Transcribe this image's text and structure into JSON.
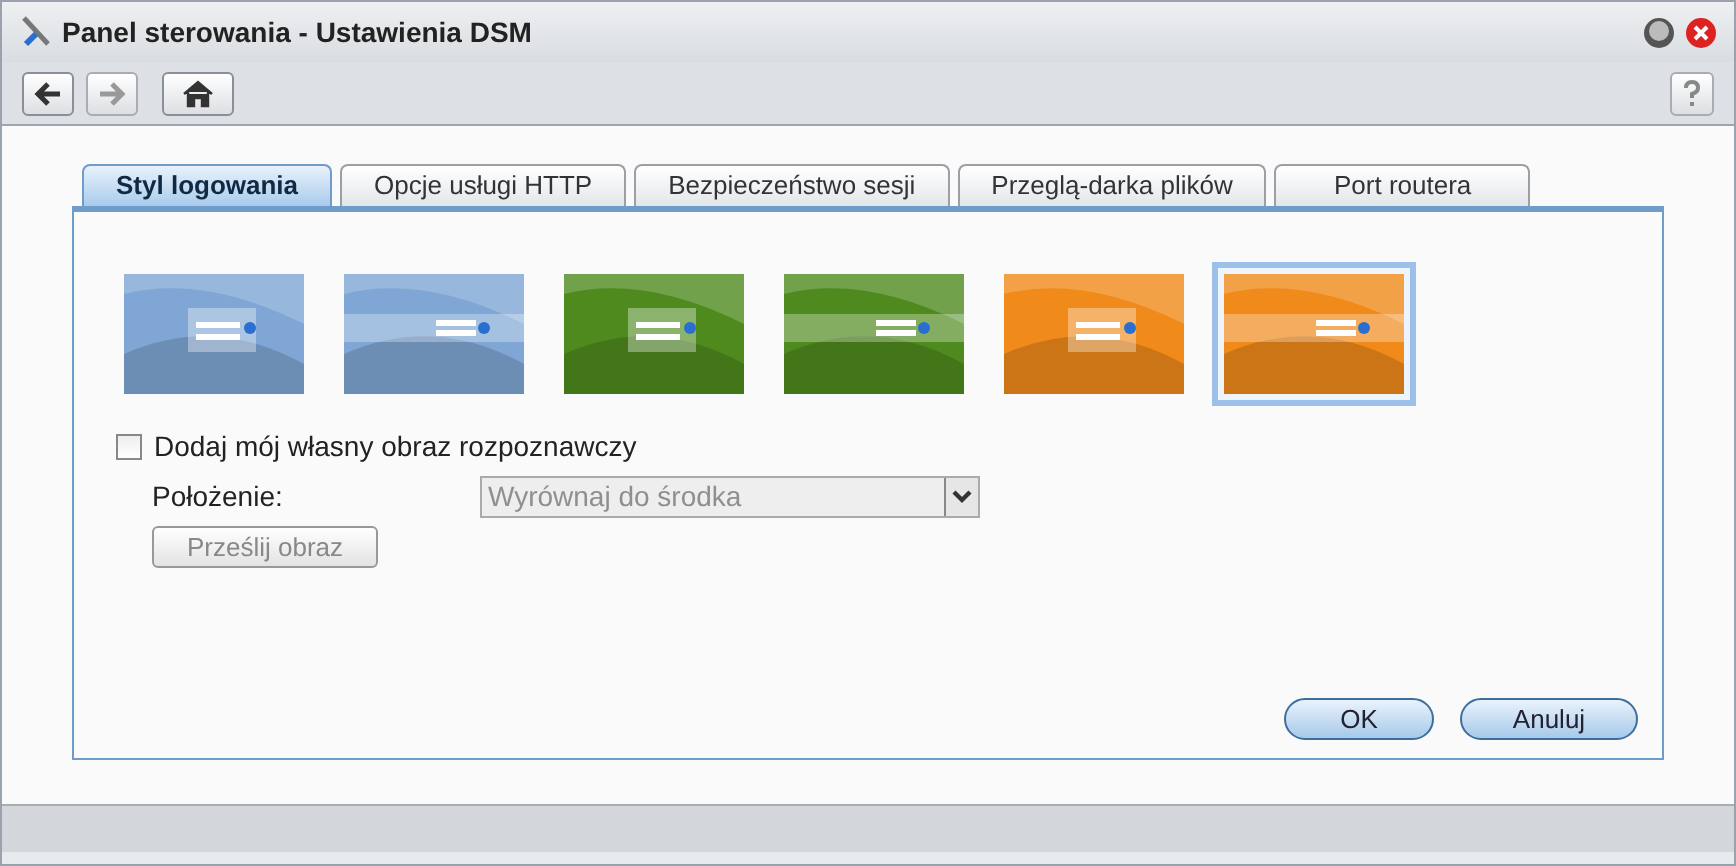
{
  "window": {
    "title": "Panel sterowania - Ustawienia DSM"
  },
  "tabs": [
    {
      "label": "Styl logowania",
      "selected": true
    },
    {
      "label": "Opcje usługi HTTP",
      "selected": false
    },
    {
      "label": "Bezpieczeństwo sesji",
      "selected": false
    },
    {
      "label": "Przeglą-darka plików",
      "selected": false
    },
    {
      "label": "Port routera",
      "selected": false
    }
  ],
  "themes": [
    {
      "kind": "box",
      "color": "#7fa6d4",
      "selected": false
    },
    {
      "kind": "bar",
      "color": "#7fa6d4",
      "selected": false
    },
    {
      "kind": "box",
      "color": "#4f8a1e",
      "selected": false
    },
    {
      "kind": "bar",
      "color": "#4f8a1e",
      "selected": false
    },
    {
      "kind": "box",
      "color": "#f08a1a",
      "selected": false
    },
    {
      "kind": "bar",
      "color": "#f08a1a",
      "selected": true
    }
  ],
  "custom_image": {
    "label": "Dodaj mój własny obraz rozpoznawczy",
    "checked": false
  },
  "position": {
    "label": "Położenie:",
    "value": "Wyrównaj do środka",
    "disabled": true
  },
  "upload_button": {
    "label": "Prześlij obraz",
    "disabled": true
  },
  "buttons": [
    "OK",
    "Anuluj"
  ]
}
